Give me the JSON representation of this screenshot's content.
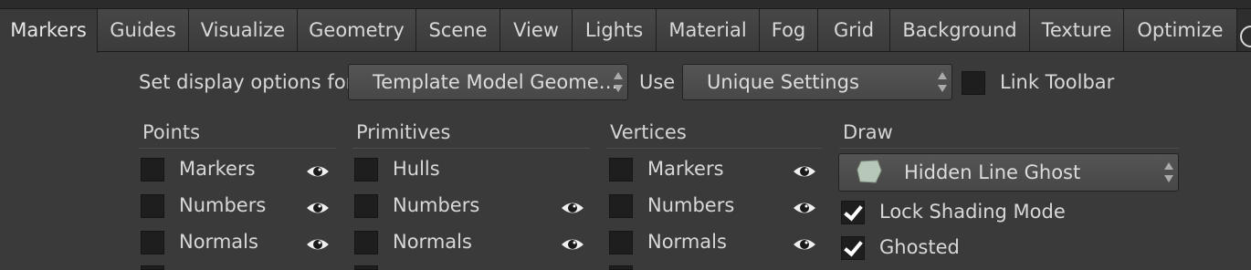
{
  "tabs": [
    {
      "label": "Markers",
      "active": true
    },
    {
      "label": "Guides"
    },
    {
      "label": "Visualize"
    },
    {
      "label": "Geometry"
    },
    {
      "label": "Scene"
    },
    {
      "label": "View"
    },
    {
      "label": "Lights"
    },
    {
      "label": "Material"
    },
    {
      "label": "Fog"
    },
    {
      "label": "Grid"
    },
    {
      "label": "Background"
    },
    {
      "label": "Texture"
    },
    {
      "label": "Optimize"
    }
  ],
  "options": {
    "set_label": "Set display options for",
    "geometry_value": "Template Model Geome…",
    "use_label": "Use",
    "settings_value": "Unique Settings",
    "link_toolbar_label": "Link Toolbar",
    "link_toolbar_checked": false
  },
  "points": {
    "title": "Points",
    "items": [
      {
        "label": "Markers",
        "checked": false
      },
      {
        "label": "Numbers",
        "checked": false
      },
      {
        "label": "Normals",
        "checked": false
      }
    ]
  },
  "primitives": {
    "title": "Primitives",
    "items": [
      {
        "label": "Hulls",
        "checked": false
      },
      {
        "label": "Numbers",
        "checked": false
      },
      {
        "label": "Normals",
        "checked": false
      }
    ]
  },
  "vertices": {
    "title": "Vertices",
    "items": [
      {
        "label": "Markers",
        "checked": false
      },
      {
        "label": "Numbers",
        "checked": false
      },
      {
        "label": "Normals",
        "checked": false
      }
    ]
  },
  "draw": {
    "title": "Draw",
    "mode_value": "Hidden Line Ghost",
    "mode_icon": "ghost-shape-icon",
    "lock_shading_label": "Lock Shading Mode",
    "lock_shading_checked": true,
    "ghosted_label": "Ghosted",
    "ghosted_checked": true
  },
  "icons": {
    "visibility": "eye-icon"
  },
  "colors": {
    "background": "#3a3a3a",
    "tabbar": "#2e2e2e",
    "checkbox": "#1e1e1e",
    "ghost_shape": "#b8c8b8"
  }
}
